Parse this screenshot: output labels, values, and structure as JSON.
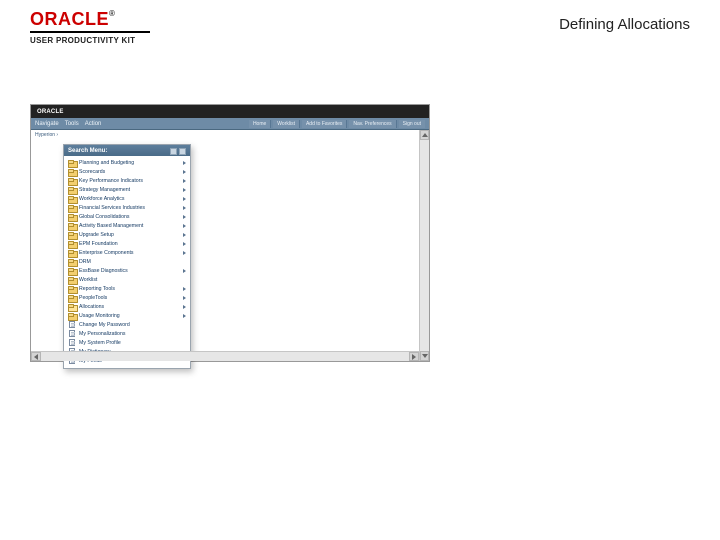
{
  "header": {
    "brand": "ORACLE",
    "tm": "®",
    "upk": "USER PRODUCTIVITY KIT",
    "title": "Defining Allocations"
  },
  "app": {
    "brand": "ORACLE",
    "nav_left": [
      "Navigate",
      "Tools",
      "Action"
    ],
    "nav_right": [
      "Home",
      "Worklist",
      "Add to Favorites",
      "Nav. Preferences",
      "Sign out"
    ],
    "crumbs": "Hyperion ›"
  },
  "menu": {
    "title": "Search Menu:",
    "items": [
      {
        "type": "folder",
        "label": "Planning and Budgeting",
        "sub": true
      },
      {
        "type": "folder",
        "label": "Scorecards",
        "sub": true
      },
      {
        "type": "folder",
        "label": "Key Performance Indicators",
        "sub": true
      },
      {
        "type": "folder",
        "label": "Strategy Management",
        "sub": true
      },
      {
        "type": "folder",
        "label": "Workforce Analytics",
        "sub": true
      },
      {
        "type": "folder",
        "label": "Financial Services Industries",
        "sub": true
      },
      {
        "type": "folder",
        "label": "Global Consolidations",
        "sub": true
      },
      {
        "type": "folder",
        "label": "Activity Based Management",
        "sub": true
      },
      {
        "type": "folder",
        "label": "Upgrade Setup",
        "sub": true
      },
      {
        "type": "folder",
        "label": "EPM Foundation",
        "sub": true
      },
      {
        "type": "folder",
        "label": "Enterprise Components",
        "sub": true
      },
      {
        "type": "folder",
        "label": "DRM",
        "sub": false
      },
      {
        "type": "folder",
        "label": "EssBase Diagnostics",
        "sub": true
      },
      {
        "type": "folder",
        "label": "Worklist",
        "sub": false
      },
      {
        "type": "folder",
        "label": "Reporting Tools",
        "sub": true
      },
      {
        "type": "folder",
        "label": "PeopleTools",
        "sub": true
      },
      {
        "type": "folder-open",
        "label": "Allocations",
        "sub": true
      },
      {
        "type": "folder",
        "label": "Usage Monitoring",
        "sub": true
      },
      {
        "type": "doc",
        "label": "Change My Password",
        "sub": false
      },
      {
        "type": "doc",
        "label": "My Personalizations",
        "sub": false
      },
      {
        "type": "doc",
        "label": "My System Profile",
        "sub": false
      },
      {
        "type": "doc",
        "label": "My Dictionary",
        "sub": false
      },
      {
        "type": "doc",
        "label": "My Feeds",
        "sub": false
      }
    ]
  }
}
